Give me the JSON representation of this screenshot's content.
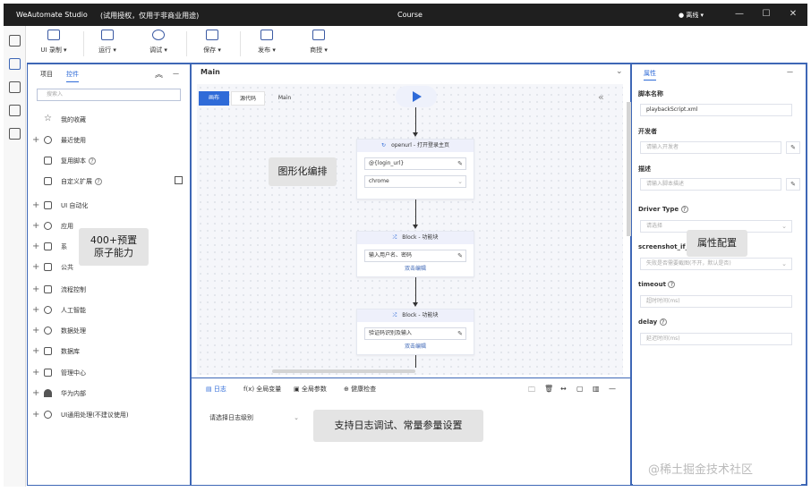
{
  "titlebar": {
    "app_name": "WeAutomate Studio",
    "license": "(试用授权，仅用于非商业用途)",
    "document": "Course",
    "status": "● 离线 ▾",
    "minimize": "—",
    "maximize": "☐",
    "close": "✕"
  },
  "toolbar": {
    "items": [
      {
        "label": "UI 录制 ▾",
        "icon": "record-icon"
      },
      {
        "label": "运行 ▾",
        "icon": "run-icon"
      },
      {
        "label": "调试 ▾",
        "icon": "debug-icon"
      },
      {
        "label": "保存 ▾",
        "icon": "save-icon"
      },
      {
        "label": "发布 ▾",
        "icon": "publish-icon"
      },
      {
        "label": "商授 ▾",
        "icon": "store-icon"
      }
    ]
  },
  "left": {
    "tab_project": "项目",
    "tab_controls": "控件",
    "collapse": "︽",
    "more": "—",
    "search_placeholder": "搜索入",
    "items": [
      {
        "label": "我的收藏",
        "plus": "",
        "help": ""
      },
      {
        "label": "最近使用",
        "plus": "+",
        "help": ""
      },
      {
        "label": "复用脚本",
        "plus": "",
        "help": "?"
      },
      {
        "label": "自定义扩展",
        "plus": "",
        "help": "?"
      },
      {
        "label": "UI 自动化",
        "plus": "+",
        "help": ""
      },
      {
        "label": "应用",
        "plus": "+",
        "help": ""
      },
      {
        "label": "系",
        "plus": "+",
        "help": ""
      },
      {
        "label": "公共",
        "plus": "+",
        "help": ""
      },
      {
        "label": "流程控制",
        "plus": "+",
        "help": ""
      },
      {
        "label": "人工智能",
        "plus": "+",
        "help": ""
      },
      {
        "label": "数据处理",
        "plus": "+",
        "help": ""
      },
      {
        "label": "数据库",
        "plus": "+",
        "help": ""
      },
      {
        "label": "管理中心",
        "plus": "+",
        "help": ""
      },
      {
        "label": "华为内部",
        "plus": "+",
        "help": ""
      },
      {
        "label": "UI通用处理(不建议使用)",
        "plus": "+",
        "help": ""
      }
    ],
    "overlay_line1": "400+预置",
    "overlay_line2": "原子能力"
  },
  "center": {
    "tab": "Main",
    "sub_tabs": [
      "画布",
      "源代码",
      "Main"
    ],
    "collapse": "«",
    "overlay": "图形化编排",
    "nodes": [
      {
        "title": "openurl - 打开登录主页",
        "fields": [
          "@{login_url}",
          "chrome"
        ],
        "edit": ""
      },
      {
        "title": "Block - 功能块",
        "fields": [
          "输入用户名、密码"
        ],
        "edit": "双击编辑"
      },
      {
        "title": "Block - 功能块",
        "fields": [
          "验证码识别及输入"
        ],
        "edit": "双击编辑"
      }
    ]
  },
  "bottom": {
    "tabs": [
      "日志",
      "全局变量",
      "全局参数",
      "健康检查"
    ],
    "log_level_placeholder": "请选择日志级别",
    "overlay": "支持日志调试、常量参量设置"
  },
  "right": {
    "tab": "属性",
    "more": "—",
    "props": [
      {
        "label": "脚本名称",
        "value": "playbackScript.xml",
        "placeholder": false,
        "pen": false,
        "select": false
      },
      {
        "label": "开发者",
        "value": "请输入开发者",
        "placeholder": true,
        "pen": true,
        "select": false
      },
      {
        "label": "描述",
        "value": "请输入脚本描述",
        "placeholder": true,
        "pen": true,
        "select": false
      },
      {
        "label": "Driver Type",
        "value": "请选择",
        "placeholder": true,
        "pen": false,
        "select": true
      },
      {
        "label": "screenshot_if_",
        "value": "失败是否需要截图(不开，默认是否)",
        "placeholder": true,
        "pen": false,
        "select": true
      },
      {
        "label": "timeout",
        "value": "超时时间(ms)",
        "placeholder": true,
        "pen": false,
        "select": false
      },
      {
        "label": "delay",
        "value": "延迟时间(ms)",
        "placeholder": true,
        "pen": false,
        "select": false
      }
    ],
    "overlay": "属性配置"
  },
  "watermark": "@稀土掘金技术社区",
  "colors": {
    "frame": "#3e67b6",
    "accent": "#2f6bd8",
    "titlebar": "#1f1f1f"
  }
}
